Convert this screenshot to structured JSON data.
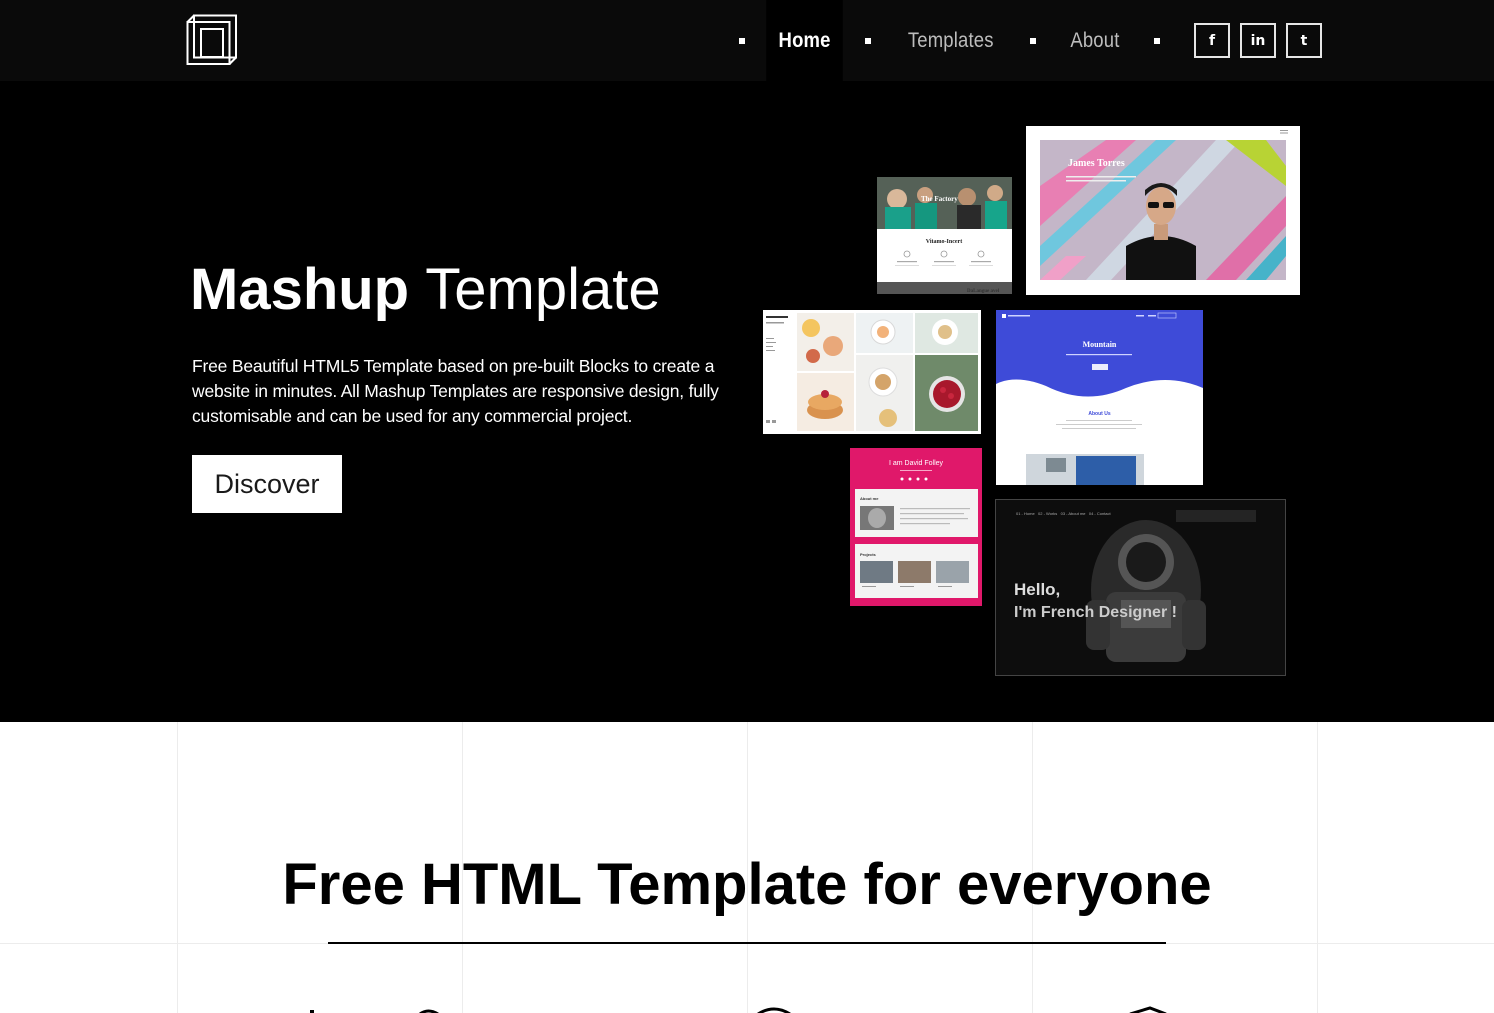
{
  "nav": {
    "items": [
      {
        "label": "Home",
        "active": true
      },
      {
        "label": "Templates",
        "active": false
      },
      {
        "label": "About",
        "active": false
      }
    ],
    "social": [
      "f",
      "in",
      "t"
    ]
  },
  "hero": {
    "title_bold": "Mashup",
    "title_light": "Template",
    "description": "Free Beautiful HTML5 Template based on pre-built Blocks to create a website in minutes. All Mashup Templates are responsive design, fully customisable and can be used for any commercial project.",
    "cta_label": "Discover"
  },
  "thumbnails": {
    "t1_title": "The Factory",
    "t1_sub": "Vitamo-Incert",
    "t1_foot": "DaLangue avel",
    "t2_name": "James Torres",
    "t4_title": "Mountain",
    "t4_about": "About Us",
    "t5_name": "I am David Folley",
    "t5_about": "About me",
    "t5_projects": "Projects",
    "t6_nav": "01 - Home   02 - Works   03 - About me   04 - Contact",
    "t6_hello": "Hello,",
    "t6_line2": "I'm French Designer !"
  },
  "section2": {
    "title": "Free HTML Template for everyone"
  },
  "colors": {
    "header_bg": "#0a0a0a",
    "hero_bg": "#000000",
    "accent_pink": "#e0186a",
    "accent_blue": "#3e4bd8"
  }
}
